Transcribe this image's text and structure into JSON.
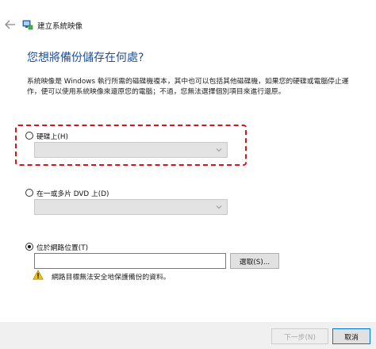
{
  "window": {
    "title": "建立系統映像"
  },
  "heading": "您想將備份儲存在何處?",
  "description": "系統映像是 Windows 執行所需的磁碟機複本，其中也可以包括其他磁碟機，如果您的硬碟或電腦停止運作，便可以使用系統映像來還原您的電腦；不過，您無法選擇個別項目來進行還原。",
  "options": {
    "hard_disk": {
      "label": "硬碟上(H)",
      "selected": false
    },
    "dvd": {
      "label": "在一或多片 DVD 上(D)",
      "selected": false
    },
    "network": {
      "label": "位於網路位置(T)",
      "selected": true,
      "path_value": "",
      "browse_label": "選取(S)..."
    }
  },
  "warning": {
    "text": "網路目標無法安全地保護備份的資料。",
    "icon": "warning-icon"
  },
  "footer": {
    "next_label": "下一步(N)",
    "cancel_label": "取消"
  },
  "colors": {
    "heading": "#1e4f9c",
    "highlight": "#d7141c",
    "accent": "#0078d7"
  }
}
